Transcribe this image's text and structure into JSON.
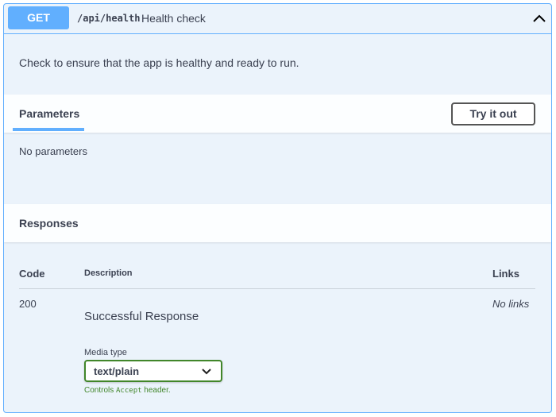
{
  "operation": {
    "method": "GET",
    "path": "/api/health",
    "summary": "Health check",
    "description": "Check to ensure that the app is healthy and ready to run.",
    "expanded_icon": "chevron-up-icon"
  },
  "parameters": {
    "tab_label": "Parameters",
    "try_button_label": "Try it out",
    "empty_text": "No parameters"
  },
  "responses": {
    "title": "Responses",
    "columns": {
      "code": "Code",
      "description": "Description",
      "links": "Links"
    },
    "rows": [
      {
        "code": "200",
        "description": "Successful Response",
        "links": "No links",
        "media_type_label": "Media type",
        "media_type_value": "text/plain",
        "controls_prefix": "Controls ",
        "controls_mono": "Accept",
        "controls_suffix": " header."
      }
    ]
  },
  "colors": {
    "accent": "#61affe",
    "background": "#ebf3fb",
    "success": "#41862a",
    "text": "#3b4151"
  }
}
